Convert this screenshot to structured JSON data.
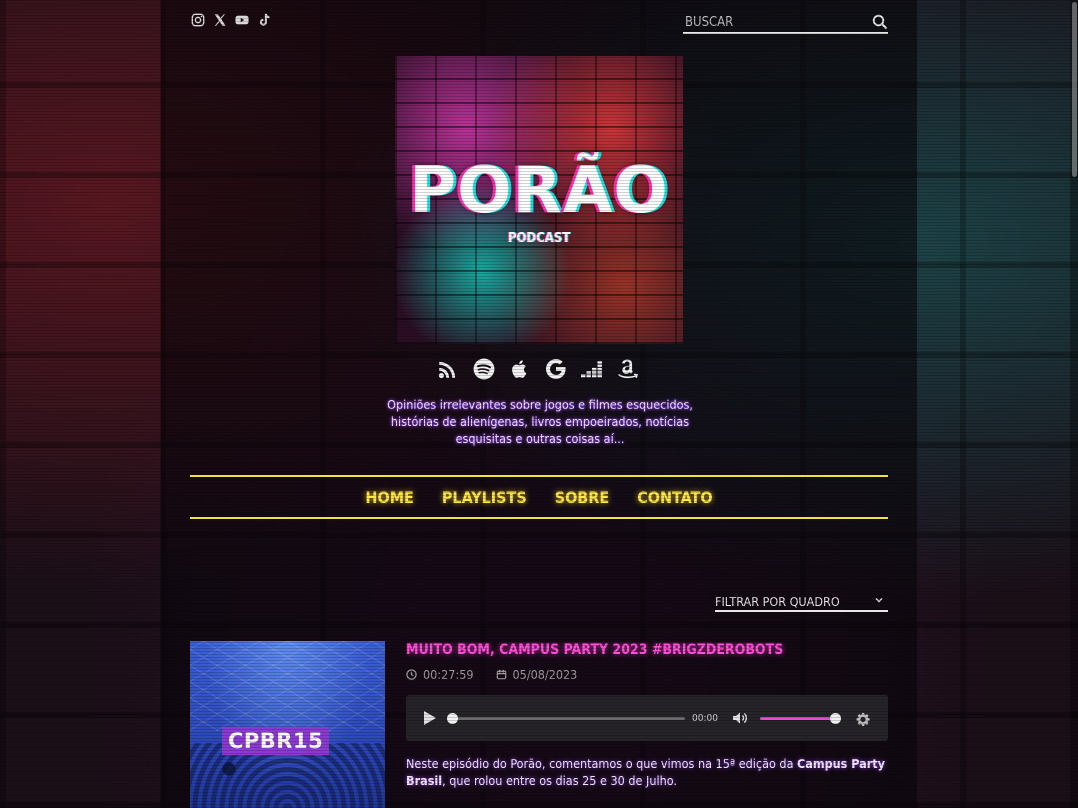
{
  "search": {
    "placeholder": "BUSCAR"
  },
  "social_icons": [
    "instagram-icon",
    "x-icon",
    "youtube-icon",
    "tiktok-icon"
  ],
  "cover": {
    "title": "PORÃO",
    "subtitle": "PODCAST"
  },
  "platform_icons": [
    "rss-icon",
    "spotify-icon",
    "apple-icon",
    "google-icon",
    "deezer-icon",
    "amazon-icon"
  ],
  "tagline": "Opiniões irrelevantes sobre jogos e filmes esquecidos, histórias de alienígenas, livros empoeirados, notícias esquisitas e outras coisas aí...",
  "nav": {
    "items": [
      "HOME",
      "PLAYLISTS",
      "SOBRE",
      "CONTATO"
    ]
  },
  "filter": {
    "label": "FILTRAR POR QUADRO"
  },
  "episode": {
    "image_text": "CPBR15",
    "title": "MUITO BOM, CAMPUS PARTY 2023 #BRIGZDEROBOTS",
    "duration": "00:27:59",
    "date": "05/08/2023",
    "player_time": "00:00",
    "progress": 0,
    "volume": 1,
    "description_part1": "Neste episódio do Porão, comentamos o que vimos na 15ª edição da ",
    "description_bold1": "Campus Party Brasil",
    "description_part2": ", que rolou entre os dias 25 e 30 de Julho."
  },
  "colors": {
    "nav_accent": "#ffe94a",
    "title_accent": "#ff4fd8",
    "volume_accent": "#e94ccf"
  }
}
